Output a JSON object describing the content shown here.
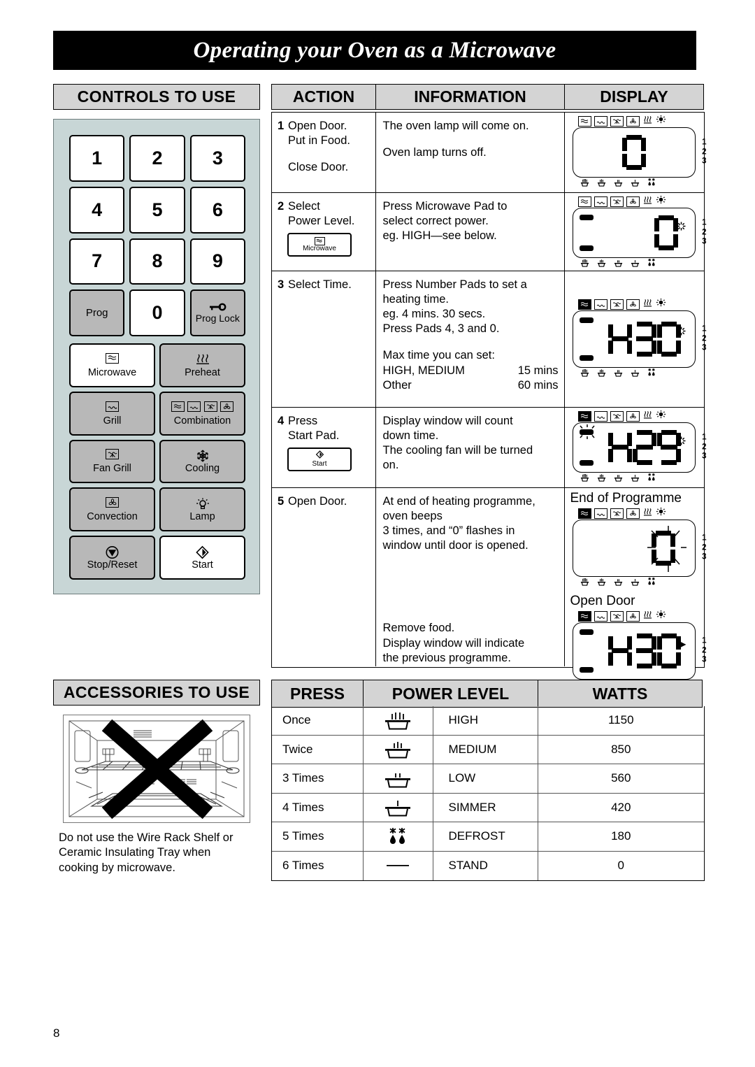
{
  "page": {
    "title": "Operating your Oven as a Microwave",
    "number": "8"
  },
  "controls": {
    "heading": "CONTROLS TO USE",
    "keys": [
      {
        "label": "1",
        "style": "white"
      },
      {
        "label": "2",
        "style": "white"
      },
      {
        "label": "3",
        "style": "white"
      },
      {
        "label": "4",
        "style": "white"
      },
      {
        "label": "5",
        "style": "white"
      },
      {
        "label": "6",
        "style": "white"
      },
      {
        "label": "7",
        "style": "white"
      },
      {
        "label": "8",
        "style": "white"
      },
      {
        "label": "9",
        "style": "white"
      },
      {
        "label": "Prog",
        "style": "grey"
      },
      {
        "label": "0",
        "style": "white"
      },
      {
        "label": "Prog Lock",
        "style": "grey",
        "icon": "key-icon"
      }
    ],
    "functions": [
      {
        "label": "Microwave",
        "style": "white",
        "icon": "microwave-wave-icon"
      },
      {
        "label": "Preheat",
        "style": "grey",
        "icon": "preheat-heat-icon"
      },
      {
        "label": "Grill",
        "style": "grey",
        "icon": "grill-icon"
      },
      {
        "label": "Combination",
        "style": "grey",
        "icon": "combination-icon"
      },
      {
        "label": "Fan Grill",
        "style": "grey",
        "icon": "fan-grill-icon"
      },
      {
        "label": "Cooling",
        "style": "grey",
        "icon": "cooling-fan-icon"
      },
      {
        "label": "Convection",
        "style": "grey",
        "icon": "convection-fan-icon"
      },
      {
        "label": "Lamp",
        "style": "grey",
        "icon": "lamp-icon"
      },
      {
        "label": "Stop/Reset",
        "style": "grey",
        "icon": "stop-icon"
      },
      {
        "label": "Start",
        "style": "white",
        "icon": "start-diamond-icon"
      }
    ]
  },
  "steps_table": {
    "headers": {
      "action": "ACTION",
      "information": "INFORMATION",
      "display": "DISPLAY"
    },
    "rows": [
      {
        "no": "1",
        "action_lines": [
          "Open Door.",
          "Put in Food.",
          "",
          "Close Door."
        ],
        "info_lines": [
          "The oven lamp will come on.",
          "",
          "",
          "Oven lamp turns off."
        ],
        "display": {
          "digits": "0",
          "dash_top": false,
          "dash_bottom": false,
          "marker": "none",
          "mw_boxed": false
        }
      },
      {
        "no": "2",
        "action_lines": [
          "Select",
          "Power Level."
        ],
        "action_button": {
          "label": "Microwave",
          "icon": "microwave-wave-icon"
        },
        "info_lines": [
          "Press Microwave Pad to",
          "select correct power.",
          "eg. HIGH—see below."
        ],
        "display": {
          "digits": "0",
          "dash_top": true,
          "dash_bottom": true,
          "marker": "flash",
          "mw_boxed": false
        }
      },
      {
        "no": "3",
        "action_lines": [
          "Select Time."
        ],
        "info_lines": [
          "Press Number Pads to set a",
          "heating time.",
          "eg. 4 mins. 30 secs.",
          "Press Pads 4, 3 and 0."
        ],
        "info_max_title": "Max time you can set:",
        "info_max_rows": [
          {
            "label": "HIGH, MEDIUM",
            "value": "15 mins"
          },
          {
            "label": "Other",
            "value": "60 mins"
          }
        ],
        "display": {
          "digits": "430",
          "dash_top": true,
          "dash_bottom": true,
          "marker": "flash",
          "mw_boxed": true
        }
      },
      {
        "no": "4",
        "action_lines": [
          "Press",
          "Start Pad."
        ],
        "action_button": {
          "label": "Start",
          "icon": "start-diamond-icon"
        },
        "info_lines": [
          "Display window will count",
          "down time.",
          "The cooling fan will be turned",
          "on."
        ],
        "display": {
          "digits": "429",
          "dash_top": true,
          "dash_top_flash": true,
          "dash_bottom": true,
          "marker": "flash",
          "mw_boxed": true
        }
      },
      {
        "no": "5",
        "action_lines": [
          "Open Door."
        ],
        "info_lines": [
          "At end of heating programme,",
          "oven beeps",
          "3 times, and “0” flashes in",
          "window until door is opened."
        ],
        "info_lines_2": [
          "Remove food.",
          "Display window will indicate",
          "the previous programme."
        ],
        "display_caption_top": "End of Programme",
        "display_caption_bottom": "Open Door",
        "display": {
          "digits": "0",
          "dash_top": false,
          "dash_bottom": false,
          "marker": "burst",
          "mw_boxed": true
        },
        "display_2": {
          "digits": "430",
          "dash_top": true,
          "dash_bottom": true,
          "marker": "triangle",
          "mw_boxed": true
        }
      }
    ],
    "lcd_side_digits": [
      "1",
      "2",
      "3"
    ]
  },
  "accessories": {
    "heading": "ACCESSORIES TO USE",
    "note_lines": [
      "Do not use the Wire Rack Shelf or",
      "Ceramic Insulating Tray when",
      "cooking by microwave."
    ]
  },
  "power_table": {
    "headers": {
      "press": "PRESS",
      "level": "POWER LEVEL",
      "watts": "WATTS"
    },
    "rows": [
      {
        "press": "Once",
        "icon": "pot-4-steam-icon",
        "level": "HIGH",
        "watts": "1150"
      },
      {
        "press": "Twice",
        "icon": "pot-3-steam-icon",
        "level": "MEDIUM",
        "watts": "850"
      },
      {
        "press": "3 Times",
        "icon": "pot-2-steam-icon",
        "level": "LOW",
        "watts": "560"
      },
      {
        "press": "4 Times",
        "icon": "pot-1-steam-icon",
        "level": "SIMMER",
        "watts": "420"
      },
      {
        "press": "5 Times",
        "icon": "defrost-icon",
        "level": "DEFROST",
        "watts": "180"
      },
      {
        "press": "6 Times",
        "icon": "dash-icon",
        "level": "STAND",
        "watts": "0"
      }
    ]
  },
  "colors": {
    "panel_bg": "#c8d6d6",
    "header_bg": "#d4d4d4",
    "key_grey": "#b8b8b8",
    "banner": "#000000"
  }
}
